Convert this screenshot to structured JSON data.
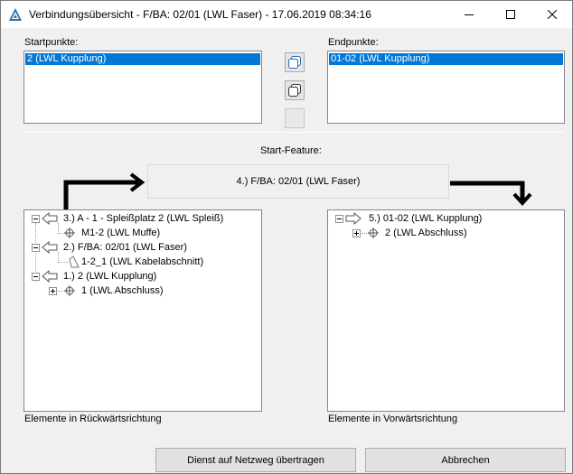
{
  "window": {
    "title": "Verbindungsübersicht - F/BA: 02/01 (LWL Faser) - 17.06.2019 08:34:16"
  },
  "start": {
    "label": "Startpunkte:",
    "items": [
      "2 (LWL Kupplung)"
    ]
  },
  "end": {
    "label": "Endpunkte:",
    "items": [
      "01-02 (LWL Kupplung)"
    ]
  },
  "feature": {
    "label": "Start-Feature:",
    "value": "4.) F/BA: 02/01 (LWL Faser)"
  },
  "backward": {
    "label": "Elemente in Rückwärtsrichtung",
    "nodes": [
      "3.) A - 1 - Spleißplatz 2 (LWL Spleiß)",
      "M1-2 (LWL Muffe)",
      "2.) F/BA: 02/01 (LWL Faser)",
      "1-2_1 (LWL Kabelabschnitt)",
      "1.) 2 (LWL Kupplung)",
      "1 (LWL Abschluss)"
    ]
  },
  "forward": {
    "label": "Elemente in Vorwärtsrichtung",
    "nodes": [
      "5.) 01-02 (LWL Kupplung)",
      "2 (LWL Abschluss)"
    ]
  },
  "buttons": {
    "transfer": "Dienst auf Netzweg übertragen",
    "cancel": "Abbrechen"
  },
  "icons": [
    "app-icon",
    "minimize-icon",
    "maximize-icon",
    "close-icon",
    "copy-icon",
    "copy-alt-icon",
    "arrow-left-icon",
    "arrow-right-icon",
    "splice-crosshair-icon",
    "fiber-section-icon"
  ],
  "colors": {
    "selection": "#0078d7",
    "arrow": "#000000"
  }
}
